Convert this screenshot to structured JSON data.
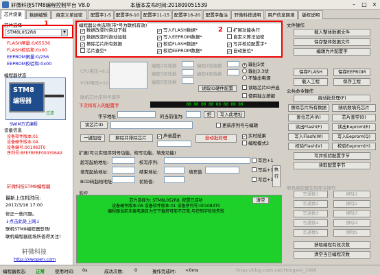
{
  "window": {
    "title": "轩微科技STM8编程控制平台 V8.0",
    "date": "本版本发布时间:201809051539"
  },
  "tabs": [
    "芯片烧录",
    "数据编辑",
    "自定义单加密",
    "配置字1-5",
    "配置字6-10",
    "配置字11-15",
    "配置字16-20",
    "配置字备注",
    "轩微科技说明",
    "用户信息回填",
    "版权说明"
  ],
  "left": {
    "chip_label": "芯片选择",
    "chip_value": "STM8L052R8",
    "mem": [
      "FLASH闸量:0/65536",
      "FLASH校验和:0x00",
      "EEPROM闸量:0/256",
      "EEPROM校验和:0x00"
    ],
    "prog_status_label": "编程器状态",
    "chip_caption": "过流",
    "swim_caption": "SWIM方式编程",
    "devinfo_label": "设备信息",
    "devinfo": [
      "设备软件版本:01",
      "设备硬件版本:0A",
      "设备编号:001083T0",
      "序列号:BFEFBFBF000306A9"
    ],
    "notice": "轩微科技STM8编程器",
    "news": [
      "最新上位机时间:",
      "2017/3/16  17:00",
      "修正一些问题。",
      "↓点击此处上网↓",
      "联机STM8编程器登场!",
      "联机编程器底场所值得关注!"
    ],
    "logo": "轩微科技",
    "url": "http://xwopen.com"
  },
  "center": {
    "opts_title": "编程器公共选项(带*号为联机有效)",
    "opts": [
      {
        "label": "数据改变时自动下载",
        "checked": true
      },
      {
        "label": "写入FLASH数据*",
        "checked": true
      },
      {
        "label": "扩展功能执行",
        "checked": false
      },
      {
        "label": "数据改变时自动加载",
        "checked": true
      },
      {
        "label": "写入EEPROM数据*",
        "checked": true
      },
      {
        "label": "自定义算法加密",
        "checked": false
      },
      {
        "label": "擦除芯片所有数据",
        "checked": true
      },
      {
        "label": "校验FLASH数据*",
        "checked": true
      },
      {
        "label": "写并校验配置字*",
        "checked": true
      },
      {
        "label": "芯片查空*",
        "checked": false
      },
      {
        "label": "校验EEPROM数据*",
        "checked": true
      },
      {
        "label": "自动复位*",
        "checked": true
      }
    ],
    "cpu_label": "CPU电压=0.1V",
    "vdd_label": "VDD电压=12.9V",
    "count_labels": [
      "编程1有效数",
      "编程2有效数",
      "编程3有效数",
      "编程4有效数",
      "编程5有效数"
    ],
    "radios": [
      "输出5伏",
      "输出3.3伏",
      "不输出电源"
    ],
    "pcb_btn": "读取ID硬件配置",
    "chk_id": "读取芯片ID开启",
    "chk_eco": "使用独立按键",
    "serial_label": "联机芯片序列号保存",
    "write_cfg_label": "联机芯片序列号保存",
    "write_cfg": "下次将写入的配置字",
    "seg_value": "00 00 00 00 00 00 00 00",
    "char_label": "字节地址",
    "addr_label": "的当前值为:",
    "write_addr_btn": "把",
    "write_to_addr_btn": "写入此地址",
    "read_id_btn": "读芯片ID",
    "hot_label": "复制到剪切板",
    "hot_chk": "更新序列号与编辑",
    "one_key_btn": "一键加密",
    "unlock_btn": "解除并排除芯片",
    "sound_chk": "声音提示",
    "auto_btn": "自动批处理",
    "realtime_chk": "实时结果",
    "mode_chk": "编程模式2",
    "ext_title": "扩展(可以实现序列号功能、校写功能、填充功能)",
    "ext_rows": [
      "超写起始地址:",
      "填充起始地址:",
      "BCD码起始地址:"
    ],
    "ext_rows2": [
      "校写序列:",
      "结束地址:",
      "初始值:"
    ],
    "ext_val": "填充值",
    "ext_inc": "写后+1",
    "ext_btn": "执行",
    "log_title": "监控",
    "log_lines": [
      "芯片选择为: STM8L052R8, 配置已成功",
      "设备硬件版本:0A 设备软件版本:01 设备序列号:001083T0",
      "编程器当前未接电源且为空下载将可能不正常,与控制字检验失败"
    ],
    "clear_btn": "清空"
  },
  "right": {
    "title": "文件操作",
    "btns": [
      "载入整体数据文件",
      "保存整体数据文件",
      "编辑为片配置字"
    ],
    "save_flash": "保存FLASH",
    "save_eeprom": "保存EEPROM",
    "load_proj": "载入工程",
    "save_proj": "保存工程",
    "common_title": "公共命令操作",
    "common_btns": [
      "自动批处理(F)",
      "擦除芯片所有数据",
      "随机数填充芯片",
      "复位芯片(R)",
      "芯片查空(B)",
      "读出Flash(F)",
      "读出Eeprom(E)",
      "写入Flash(W)",
      "写入Eeprom(Q)",
      "校验Flash(V)",
      "校验Eeprom(H)",
      "写并校验配置字节",
      "读取配置字节"
    ],
    "multi_title": "联机编程器专用命令操作",
    "multi": [
      "写通数1",
      "写通数2",
      "写通数3",
      "写通数4",
      "写通数5"
    ],
    "multi2": [
      "擦除1",
      "擦除2",
      "擦除3",
      "擦除4",
      "擦除5"
    ],
    "get_count": "获取编程有效次数",
    "clear_count": "清空当日编程次数"
  },
  "status": {
    "state_label": "编程器状态:",
    "state": "正常",
    "use_label": "使用时间:",
    "use": "0s",
    "success_label": "成功次数:",
    "success": "0",
    "time_label": "操作完成时:",
    "time": "<0ms",
    "watermark": "https://blog.csdn.net/Hongwei_1990"
  },
  "annot": {
    "n1": "1",
    "n2": "2"
  }
}
